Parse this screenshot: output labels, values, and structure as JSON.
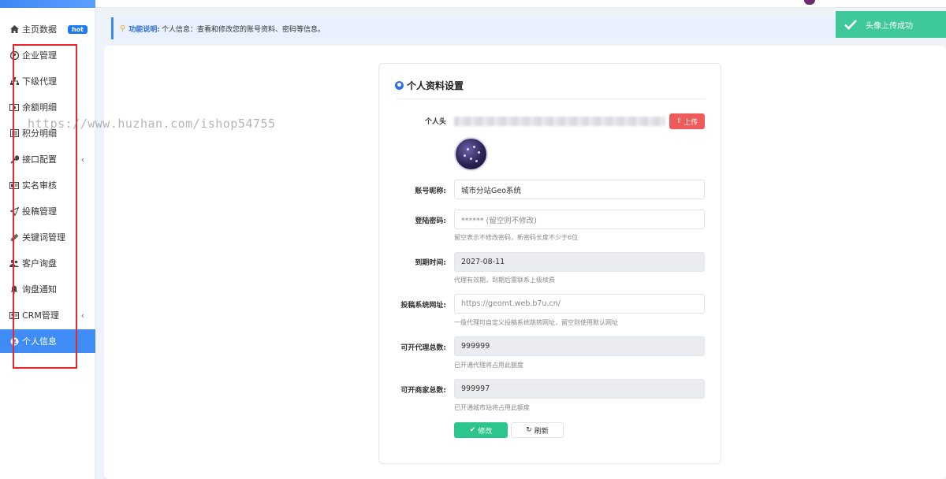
{
  "sidebar": {
    "items": [
      {
        "label": "主页数据",
        "icon": "home-icon",
        "badge": "hot"
      },
      {
        "label": "企业管理",
        "icon": "building-icon"
      },
      {
        "label": "下级代理",
        "icon": "sitemap-icon"
      },
      {
        "label": "余额明细",
        "icon": "money-icon"
      },
      {
        "label": "积分明细",
        "icon": "list-icon"
      },
      {
        "label": "接口配置",
        "icon": "wrench-icon",
        "caret": "‹"
      },
      {
        "label": "实名审核",
        "icon": "id-card-icon"
      },
      {
        "label": "投稿管理",
        "icon": "send-icon"
      },
      {
        "label": "关键词管理",
        "icon": "tag-icon"
      },
      {
        "label": "客户询盘",
        "icon": "users-icon"
      },
      {
        "label": "询盘通知",
        "icon": "bell-icon"
      },
      {
        "label": "CRM管理",
        "icon": "address-card-icon",
        "caret": "‹"
      },
      {
        "label": "个人信息",
        "icon": "user-circle-icon",
        "active": true
      }
    ]
  },
  "notice": {
    "label": "功能说明:",
    "text": "个人信息：查看和修改您的账号资料、密码等信息。"
  },
  "toast": {
    "text": "头像上传成功"
  },
  "form": {
    "title": "个人资料设置",
    "avatar_label": "个人头",
    "upload_label": "上传",
    "nickname": {
      "label": "账号昵称:",
      "value": "城市分站Geo系统"
    },
    "password": {
      "label": "登陆密码:",
      "placeholder": "****** (留空则不修改)",
      "help": "留空表示不修改密码，新密码长度不少于6位"
    },
    "expiry": {
      "label": "到期时间:",
      "value": "2027-08-11",
      "help": "代理有效期，到期后需联系上级续费"
    },
    "submit_url": {
      "label": "投稿系统网址:",
      "placeholder": "https://geomt.web.b7u.cn/",
      "help": "一级代理可自定义投稿系统跳转网址，留空则使用默认网址"
    },
    "agent_total": {
      "label": "可开代理总数:",
      "value": "999999",
      "help": "已开通代理将占用此额度"
    },
    "merchant_total": {
      "label": "可开商家总数:",
      "value": "999997",
      "help": "已开通城市站将占用此额度"
    },
    "save_label": "修改",
    "refresh_label": "刷新"
  },
  "watermark": "https://www.huzhan.com/ishop54755",
  "colors": {
    "accent": "#3f8cf6",
    "success": "#2dc58e",
    "danger": "#ef5a5a",
    "toast": "#3fc89a"
  }
}
